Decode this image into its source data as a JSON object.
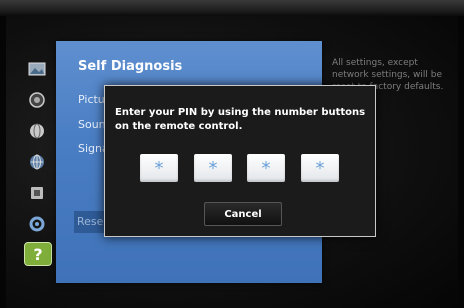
{
  "panel": {
    "title": "Self Diagnosis",
    "menu_items": [
      "Pictu",
      "Soun",
      "Signa"
    ],
    "selected_item": "Rese"
  },
  "side_description": "All settings, except network settings, will be reset to factory defaults.",
  "pin_dialog": {
    "message": "Enter your PIN by using the number buttons on the remote control.",
    "digits": [
      "*",
      "*",
      "*",
      "*"
    ],
    "cancel_label": "Cancel"
  },
  "sidebar": {
    "icons": [
      "picture-icon",
      "sound-icon",
      "broadcast-icon",
      "network-icon",
      "system-icon",
      "support-icon",
      "help-icon"
    ],
    "help_label": "?"
  },
  "colors": {
    "panel_blue": "#4a7ec4",
    "dialog_bg": "#1b1b1b",
    "pin_star": "#6aa0d8",
    "help_green": "#7fae3a"
  }
}
